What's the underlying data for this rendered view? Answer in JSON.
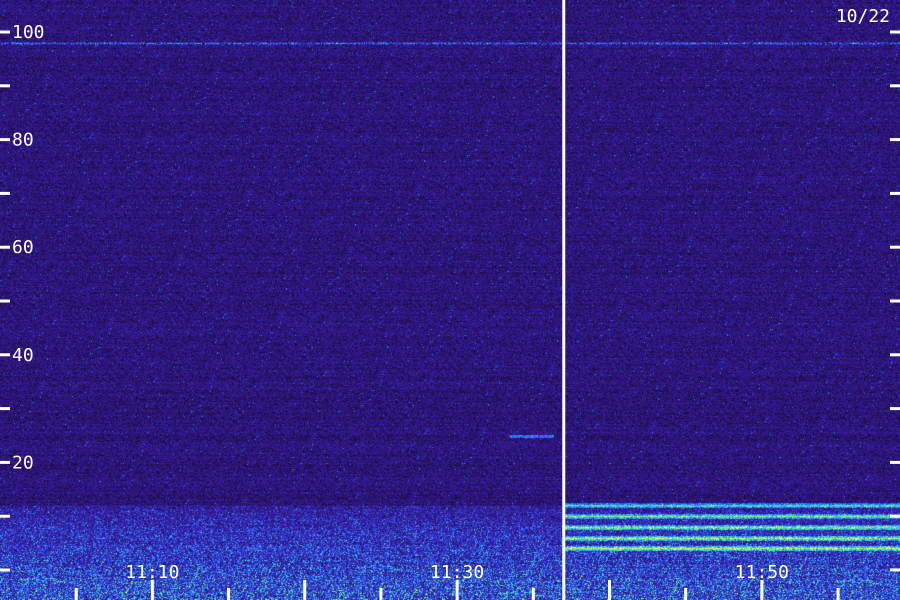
{
  "chart_data": {
    "type": "heatmap",
    "title": "",
    "xlabel": "",
    "ylabel": "",
    "date_label": "10/22",
    "time_range": [
      "11:00",
      "11:59"
    ],
    "ylim": [
      0,
      100
    ],
    "y_major_ticks": [
      0,
      20,
      40,
      60,
      80,
      100
    ],
    "y_major_labels": [
      "20",
      "40",
      "60",
      "80",
      "100"
    ],
    "y_minor_ticks": [
      10,
      30,
      50,
      70,
      90
    ],
    "x_tick_times": [
      "11:05",
      "11:10",
      "11:15",
      "11:20",
      "11:25",
      "11:30",
      "11:35",
      "11:40",
      "11:45",
      "11:50",
      "11:55"
    ],
    "x_tick_labels": [
      "11:10",
      "11:30",
      "11:50"
    ],
    "marker_time": "11:37",
    "colormap": [
      "#120826",
      "#2a1470",
      "#3a20b0",
      "#3060ff",
      "#30c0ff",
      "#60ff60",
      "#ffff60"
    ],
    "features": [
      {
        "kind": "band",
        "y": 98,
        "intensity": 0.6
      },
      {
        "kind": "band",
        "y": 25,
        "intensity": 0.55,
        "time_from": "11:35",
        "time_to": "11:36"
      },
      {
        "kind": "noise-floor",
        "y_from": 0,
        "y_to": 12,
        "intensity": 0.7
      },
      {
        "kind": "bands",
        "time_from": "11:37",
        "time_to": "11:59",
        "y": [
          6,
          8,
          10,
          12,
          4
        ],
        "intensity": 0.9
      }
    ]
  }
}
